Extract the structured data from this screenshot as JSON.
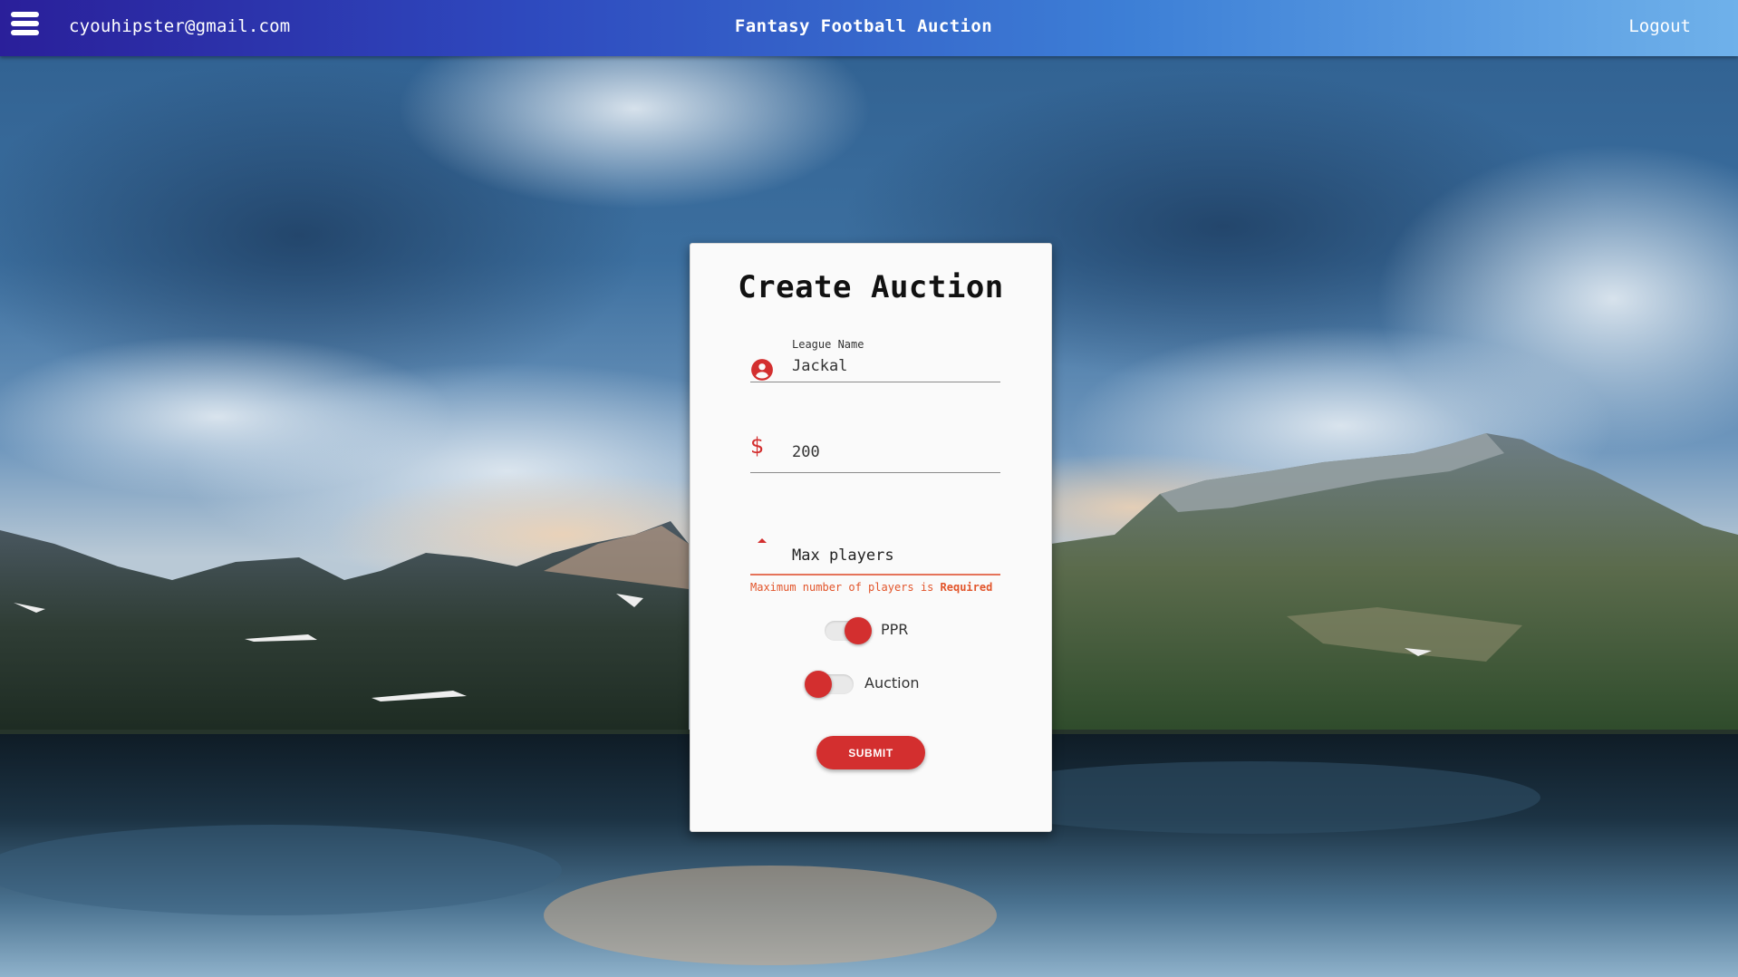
{
  "header": {
    "menu_icon": "hamburger-menu-icon",
    "user_email": "cyouhipster@gmail.com",
    "app_title": "Fantasy Football Auction",
    "logout_label": "Logout"
  },
  "form": {
    "title": "Create Auction",
    "league_name": {
      "icon": "account-circle-icon",
      "label": "League Name",
      "value": "Jackal"
    },
    "budget": {
      "icon": "dollar-sign-icon",
      "value": "200"
    },
    "max_players": {
      "icon": "caret-up-icon",
      "placeholder": "Max players",
      "value": "",
      "error_text": "Maximum number of players is",
      "error_emphasis": "Required"
    },
    "toggles": [
      {
        "label": "PPR",
        "on": true
      },
      {
        "label": "Auction",
        "on": false
      }
    ],
    "submit_label": "SUBMIT"
  },
  "colors": {
    "accent": "#d32f2f",
    "error": "#e2552b",
    "header_gradient_start": "#2a1f9a",
    "header_gradient_end": "#6fb1ea",
    "card_background": "#fafafa"
  }
}
